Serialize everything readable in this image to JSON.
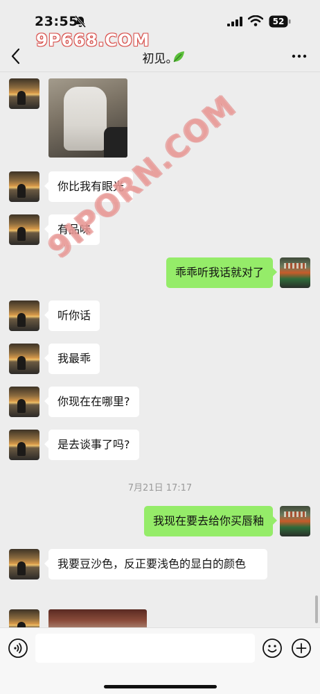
{
  "status_bar": {
    "time": "23:55",
    "battery": "52"
  },
  "watermarks": {
    "top": "9P668.COM",
    "diagonal": "9IPORN.COM"
  },
  "nav": {
    "title": "初见。"
  },
  "messages": [
    {
      "side": "left",
      "type": "image"
    },
    {
      "side": "left",
      "type": "text",
      "text": "你比我有眼光"
    },
    {
      "side": "left",
      "type": "text",
      "text": "有品味"
    },
    {
      "side": "right",
      "type": "text",
      "text": "乖乖听我话就对了"
    },
    {
      "side": "left",
      "type": "text",
      "text": "听你话"
    },
    {
      "side": "left",
      "type": "text",
      "text": "我最乖"
    },
    {
      "side": "left",
      "type": "text",
      "text": "你现在在哪里?"
    },
    {
      "side": "left",
      "type": "text",
      "text": "是去谈事了吗?"
    },
    {
      "type": "timestamp",
      "text": "7月21日 17:17"
    },
    {
      "side": "right",
      "type": "text",
      "text": "我现在要去给你买唇釉"
    },
    {
      "side": "left",
      "type": "text",
      "text": "我要豆沙色，反正要浅色的显白的颜色"
    },
    {
      "side": "left",
      "type": "image"
    }
  ],
  "input": {
    "placeholder": ""
  },
  "colors": {
    "background": "#ededed",
    "bubble_outgoing": "#95ec69",
    "bubble_incoming": "#ffffff"
  }
}
